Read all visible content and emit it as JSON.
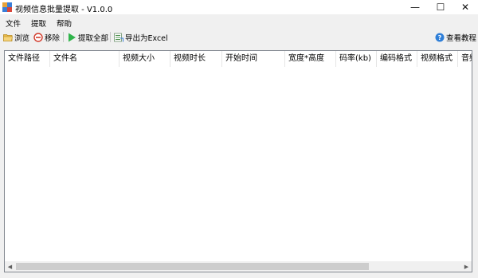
{
  "window": {
    "title": "视频信息批量提取 - V1.0.0",
    "minimize_glyph": "—",
    "maximize_glyph": "☐",
    "close_glyph": "✕"
  },
  "menu": [
    "文件",
    "提取",
    "帮助"
  ],
  "toolbar": {
    "browse": "浏览",
    "remove": "移除",
    "extract_all": "提取全部",
    "export_excel": "导出为Excel",
    "tutorial": "查看教程"
  },
  "table": {
    "columns": [
      "文件路径",
      "文件名",
      "视频大小",
      "视频时长",
      "开始时间",
      "宽度*高度",
      "码率(kb)",
      "编码格式",
      "视频格式",
      "音频"
    ],
    "rows": []
  },
  "scrollbar": {
    "left_arrow": "◀",
    "right_arrow": "▶"
  },
  "colors": {
    "background": "#f0f0f0",
    "list_border": "#828790",
    "scroll_thumb": "#cdcdcd"
  }
}
